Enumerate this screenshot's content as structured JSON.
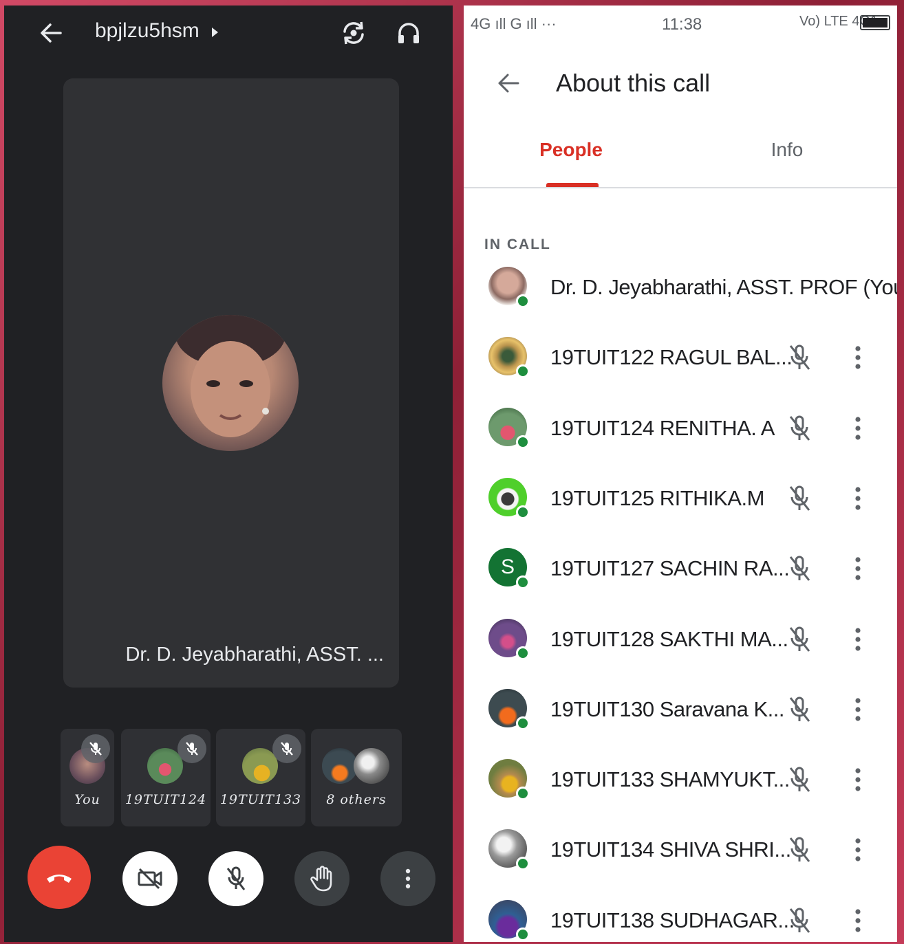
{
  "call": {
    "meeting_code": "bpjlzu5hsm",
    "main_tile_name": "Dr. D. Jeyabharathi, ASST. ...",
    "thumbnails": [
      {
        "label": "You",
        "muted": true
      },
      {
        "label": "19TUIT124",
        "muted": true
      },
      {
        "label": "19TUIT133",
        "muted": true
      },
      {
        "label": "8 others",
        "muted": false
      }
    ],
    "controls": {
      "end_call_color": "#ea4335",
      "camera_off": true,
      "mic_off": true
    }
  },
  "status_bar": {
    "network_left": "4G ıll G ıll ···",
    "time": "11:38",
    "network_right": "Vo) LTE 4G1"
  },
  "about": {
    "title": "About this call",
    "tabs": [
      {
        "label": "People",
        "active": true
      },
      {
        "label": "Info",
        "active": false
      }
    ],
    "section_label": "IN CALL",
    "people": [
      {
        "name": "Dr. D. Jeyabharathi, ASST. PROF (You)",
        "initial": "",
        "muted": false,
        "show_menu": false
      },
      {
        "name": "19TUIT122 RAGUL BAL...",
        "initial": "",
        "muted": true,
        "show_menu": true
      },
      {
        "name": "19TUIT124 RENITHA. A",
        "initial": "",
        "muted": true,
        "show_menu": true
      },
      {
        "name": "19TUIT125 RITHIKA.M",
        "initial": "",
        "muted": true,
        "show_menu": true
      },
      {
        "name": "19TUIT127 SACHIN RA...",
        "initial": "S",
        "muted": true,
        "show_menu": true
      },
      {
        "name": "19TUIT128 SAKTHI MA...",
        "initial": "",
        "muted": true,
        "show_menu": true
      },
      {
        "name": "19TUIT130 Saravana K...",
        "initial": "",
        "muted": true,
        "show_menu": true
      },
      {
        "name": "19TUIT133 SHAMYUKT...",
        "initial": "",
        "muted": true,
        "show_menu": true
      },
      {
        "name": "19TUIT134 SHIVA SHRI...",
        "initial": "",
        "muted": true,
        "show_menu": true
      },
      {
        "name": "19TUIT138 SUDHAGAR...",
        "initial": "",
        "muted": true,
        "show_menu": true
      }
    ]
  },
  "colors": {
    "accent": "#d93025",
    "online": "#1e8e3e",
    "dark_bg": "#202124",
    "tile_bg": "#303134"
  }
}
